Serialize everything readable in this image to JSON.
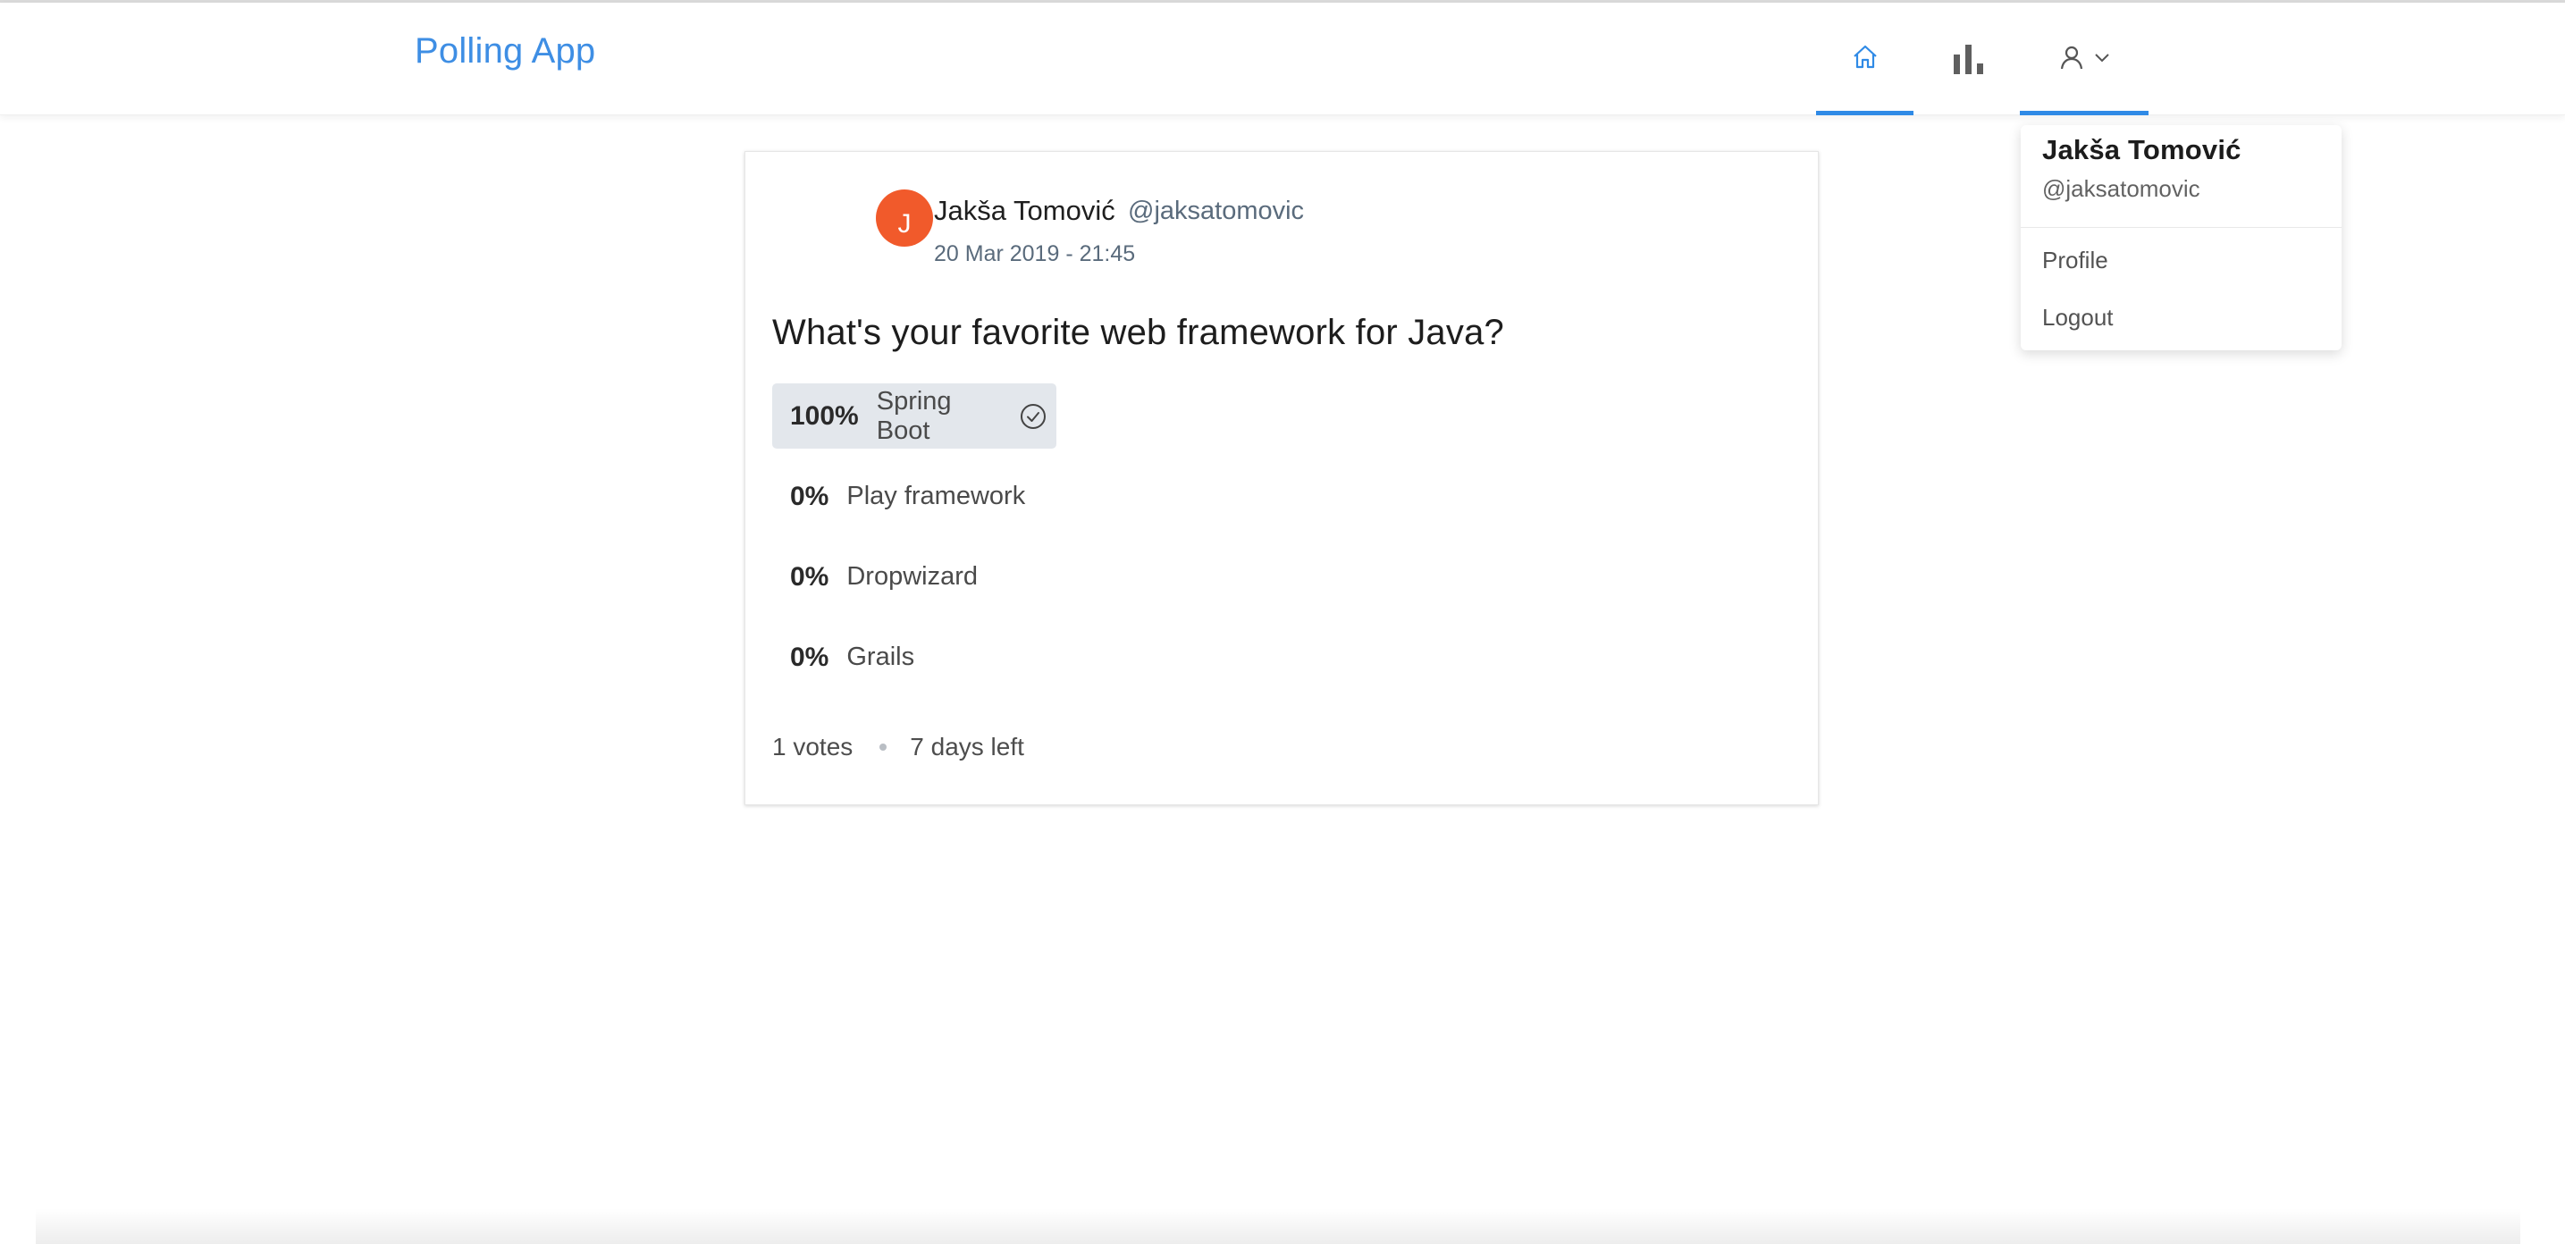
{
  "app": {
    "title": "Polling App"
  },
  "nav": {
    "home_icon": "home-icon",
    "poll_icon": "bar-chart-icon",
    "user_icon": "user-icon",
    "active_color": "#2f8ae6"
  },
  "dropdown": {
    "name": "Jakša Tomović",
    "username": "@jaksatomovic",
    "items": [
      "Profile",
      "Logout"
    ]
  },
  "poll": {
    "avatar_letter": "J",
    "avatar_color": "#f15a2b",
    "creator_name": "Jakša Tomović",
    "creator_username": "@jaksatomovic",
    "created": "20 Mar 2019 - 21:45",
    "question": "What's your favorite web framework for Java?",
    "choices": [
      {
        "percent": "100%",
        "text": "Spring Boot",
        "selected": true
      },
      {
        "percent": "0%",
        "text": "Play framework",
        "selected": false
      },
      {
        "percent": "0%",
        "text": "Dropwizard",
        "selected": false
      },
      {
        "percent": "0%",
        "text": "Grails",
        "selected": false
      }
    ],
    "votes": "1 votes",
    "time_left": "7 days left"
  }
}
